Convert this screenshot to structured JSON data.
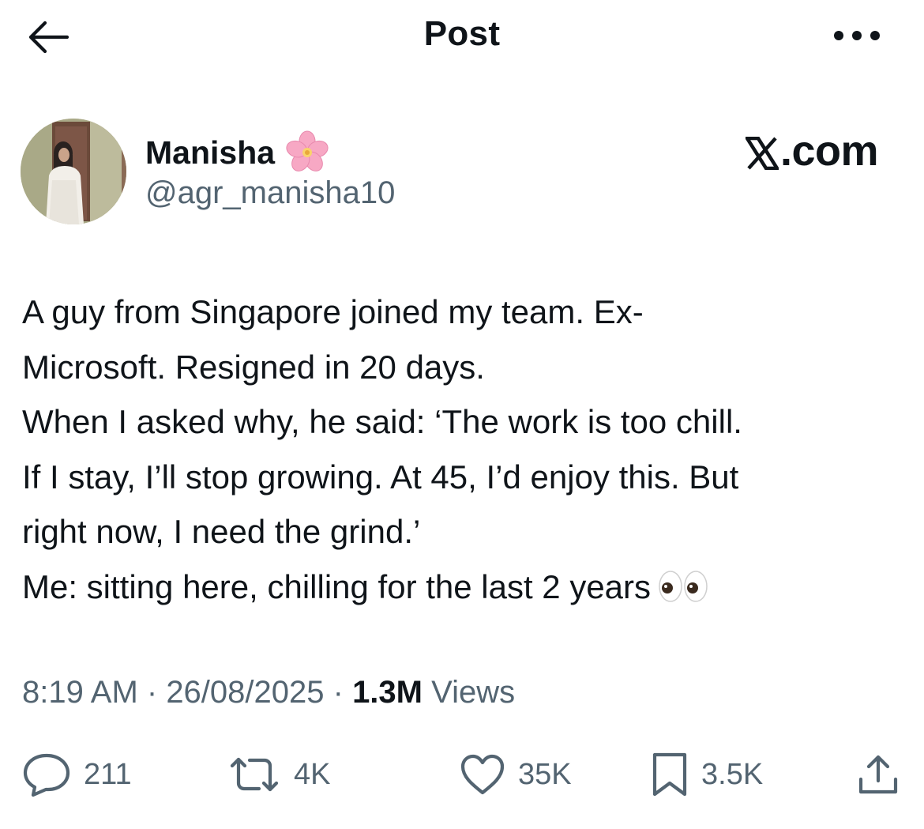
{
  "header": {
    "title": "Post",
    "back_icon": "arrow-left-icon",
    "more_icon": "more-horizontal-icon"
  },
  "author": {
    "name": "Manisha",
    "handle": "@agr_manisha10",
    "badge_emoji": "cherry-blossom-icon"
  },
  "watermark": {
    "text": ".com",
    "logo_icon": "x-logo-icon"
  },
  "tweet": {
    "lines": [
      "A guy from Singapore joined my team. Ex-",
      "Microsoft. Resigned in 20 days.",
      "When I asked why, he said: ‘The work is too chill.",
      "If I stay, I’ll stop growing. At 45, I’d enjoy this. But",
      "right now, I need the grind.’",
      "Me: sitting here, chilling for the last 2 years"
    ],
    "trailing_emoji": "eyes-icon"
  },
  "meta": {
    "time": "8:19 AM",
    "date": "26/08/2025",
    "separator": " · ",
    "views_count": "1.3M",
    "views_label": "Views"
  },
  "actions": {
    "replies": "211",
    "reposts": "4K",
    "likes": "35K",
    "bookmarks": "3.5K"
  },
  "colors": {
    "text_primary": "#0f1419",
    "text_secondary": "#536471",
    "background": "#ffffff"
  }
}
